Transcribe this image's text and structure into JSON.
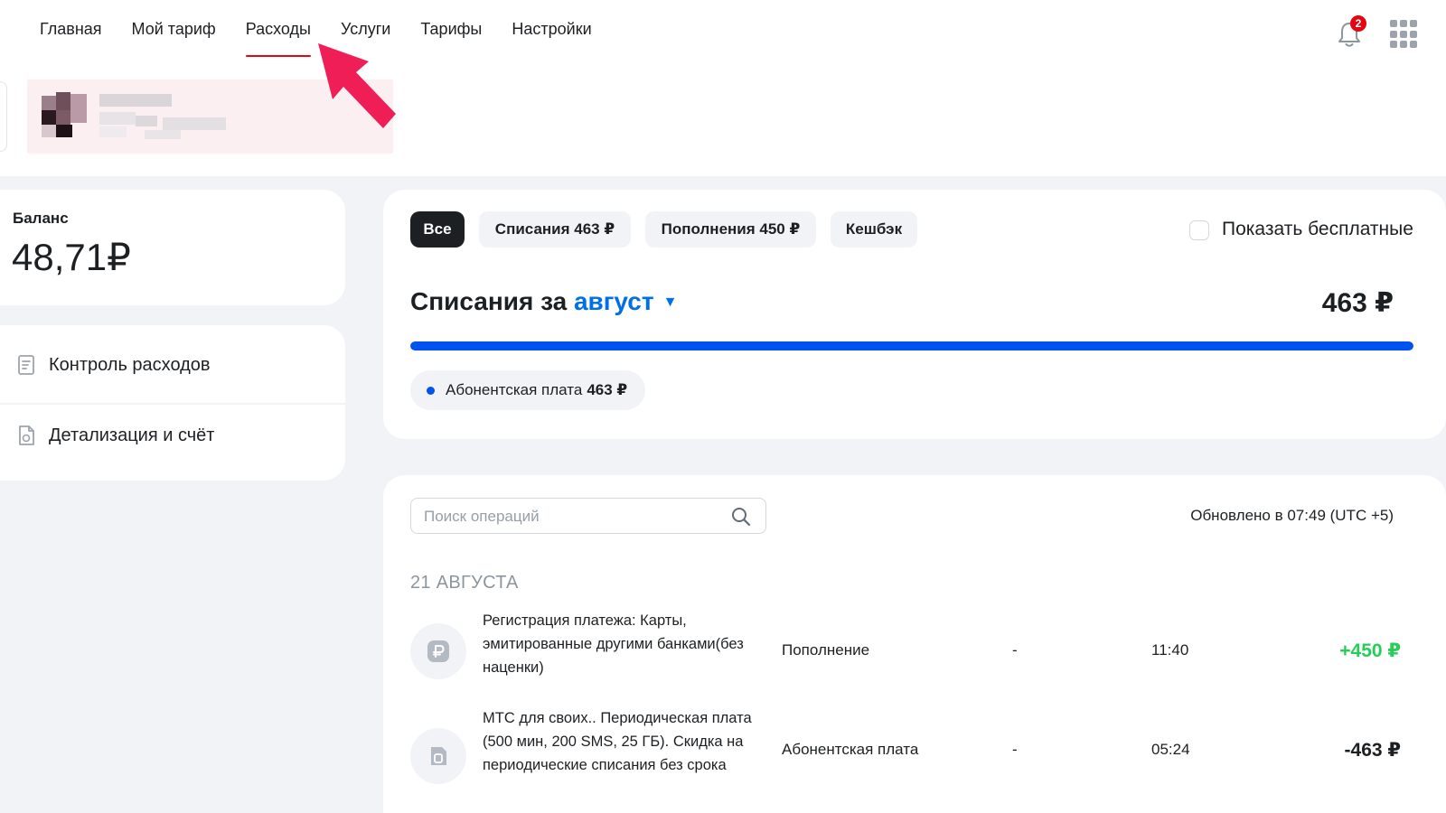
{
  "nav": {
    "items": [
      {
        "label": "Главная"
      },
      {
        "label": "Мой тариф"
      },
      {
        "label": "Расходы"
      },
      {
        "label": "Услуги"
      },
      {
        "label": "Тарифы"
      },
      {
        "label": "Настройки"
      }
    ],
    "active_index": 2
  },
  "notifications": {
    "count": "2",
    "icon": "bell-icon"
  },
  "apps_icon": "apps-grid-icon",
  "balance": {
    "label": "Баланс",
    "value": "48,71₽"
  },
  "menu": {
    "items": [
      {
        "label": "Контроль расходов",
        "icon": "receipt-icon"
      },
      {
        "label": "Детализация и счёт",
        "icon": "document-icon"
      }
    ]
  },
  "filters": {
    "chips": [
      {
        "label": "Все",
        "active": true
      },
      {
        "label": "Списания 463 ₽",
        "active": false
      },
      {
        "label": "Пополнения 450 ₽",
        "active": false
      },
      {
        "label": "Кешбэк",
        "active": false
      }
    ],
    "show_free_label": "Показать бесплатные",
    "show_free_checked": false
  },
  "period": {
    "title_prefix": "Списания за",
    "month": "август",
    "total": "463 ₽",
    "progress_fraction": 1.0
  },
  "legend": {
    "label": "Абонентская плата",
    "amount": "463 ₽"
  },
  "search": {
    "placeholder": "Поиск операций"
  },
  "updated": "Обновлено в 07:49 (UTC +5)",
  "date_header": "21 АВГУСТА",
  "operations": [
    {
      "icon": "ruble-card-icon",
      "desc": "Регистрация платежа: Карты, эмитированные другими банками(без наценки)",
      "type": "Пополнение",
      "dash": "-",
      "time": "11:40",
      "amount": "+450 ₽",
      "sign": "plus"
    },
    {
      "icon": "sim-card-icon",
      "desc": "МТС для своих.. Периодическая плата (500 мин, 200 SMS, 25 ГБ). Скидка на периодические списания без срока",
      "type": "Абонентская плата",
      "dash": "-",
      "time": "05:24",
      "amount": "-463 ₽",
      "sign": "minus"
    }
  ],
  "colors": {
    "brand_red": "#E30611",
    "accent_blue": "#0070E5",
    "progress_blue": "#0053F0",
    "income_green": "#26CD58",
    "annotation_arrow": "#F01E56"
  }
}
